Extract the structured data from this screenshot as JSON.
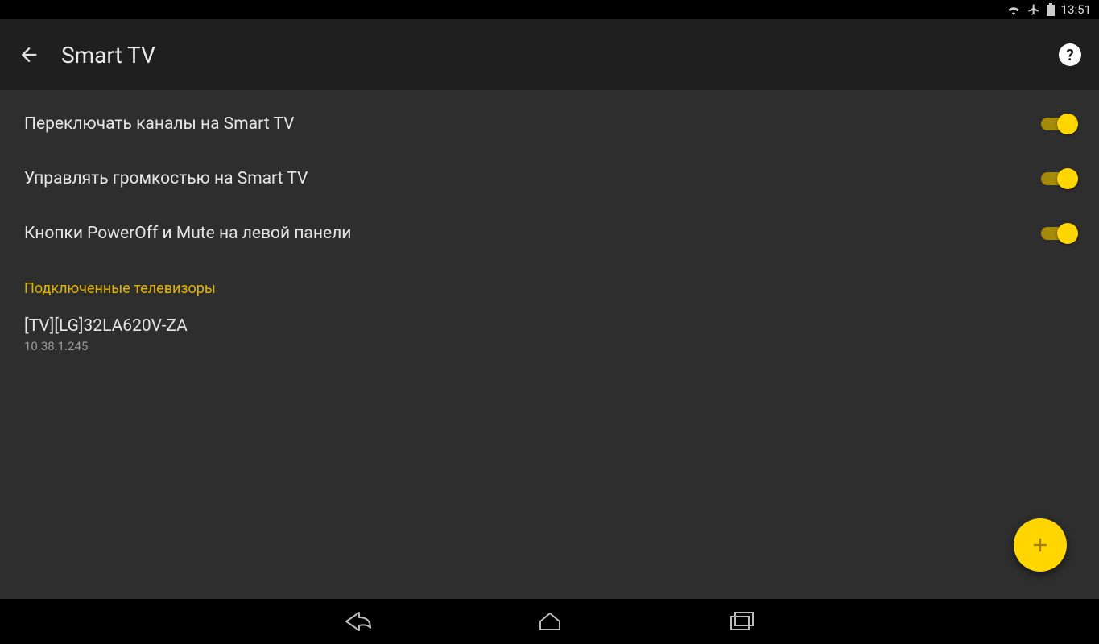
{
  "status": {
    "time": "13:51"
  },
  "header": {
    "title": "Smart TV"
  },
  "settings": [
    {
      "label": "Переключать каналы на Smart TV",
      "on": true
    },
    {
      "label": "Управлять громкостью на Smart TV",
      "on": true
    },
    {
      "label": "Кнопки PowerOff и Mute на левой панели",
      "on": true
    }
  ],
  "section_title": "Подключенные телевизоры",
  "devices": [
    {
      "name": "[TV][LG]32LA620V-ZA",
      "ip": "10.38.1.245"
    }
  ]
}
